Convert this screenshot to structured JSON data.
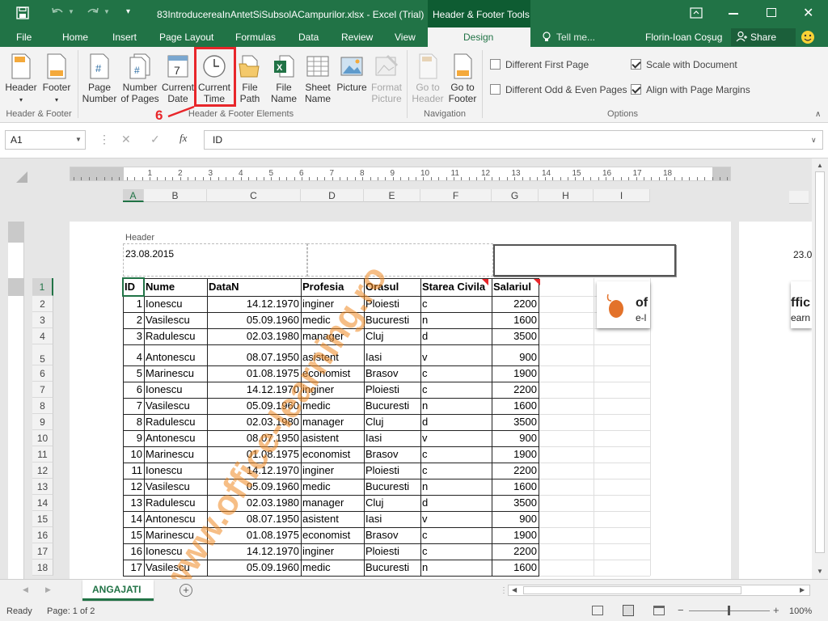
{
  "window": {
    "title": "83IntroducereaInAntetSiSubsolACampurilor.xlsx - Excel (Trial)",
    "contextual_tab": "Header & Footer Tools",
    "user": "Florin-Ioan Coşug",
    "share": "Share",
    "tell_me": "Tell me..."
  },
  "tabs": [
    "File",
    "Home",
    "Insert",
    "Page Layout",
    "Formulas",
    "Data",
    "Review",
    "View",
    "Design"
  ],
  "ribbon": {
    "hf_group": {
      "label": "Header & Footer",
      "header": "Header",
      "footer": "Footer"
    },
    "elements_group": {
      "label": "Header & Footer Elements",
      "items": [
        {
          "l1": "Page",
          "l2": "Number"
        },
        {
          "l1": "Number",
          "l2": "of Pages"
        },
        {
          "l1": "Current",
          "l2": "Date"
        },
        {
          "l1": "Current",
          "l2": "Time"
        },
        {
          "l1": "File",
          "l2": "Path"
        },
        {
          "l1": "File",
          "l2": "Name"
        },
        {
          "l1": "Sheet",
          "l2": "Name"
        },
        {
          "l1": "Picture",
          "l2": ""
        },
        {
          "l1": "Format",
          "l2": "Picture"
        }
      ]
    },
    "nav_group": {
      "label": "Navigation",
      "goto_header_1": "Go to",
      "goto_header_2": "Header",
      "goto_footer_1": "Go to",
      "goto_footer_2": "Footer"
    },
    "options_group": {
      "label": "Options",
      "diff_first": "Different First Page",
      "diff_odd_even": "Different Odd & Even Pages",
      "scale_doc": "Scale with Document",
      "align_margins": "Align with Page Margins",
      "diff_first_checked": false,
      "diff_odd_even_checked": false,
      "scale_doc_checked": true,
      "align_margins_checked": true
    },
    "annotation": "6"
  },
  "formula_bar": {
    "name_box": "A1",
    "content": "ID"
  },
  "ruler": {
    "numbers": [
      "1",
      "2",
      "3",
      "4",
      "5",
      "6",
      "7",
      "8",
      "9",
      "10",
      "11",
      "12",
      "13",
      "14",
      "15",
      "16",
      "17",
      "18"
    ]
  },
  "columns": [
    "A",
    "B",
    "C",
    "D",
    "E",
    "F",
    "G",
    "H",
    "I"
  ],
  "page": {
    "header_label": "Header",
    "header_left": "23.08.2015",
    "page2_header_partial": "23.0"
  },
  "table": {
    "headers": [
      "ID",
      "Nume",
      "DataN",
      "Profesia",
      "Orasul",
      "Starea Civila",
      "Salariul"
    ],
    "rows": [
      [
        "1",
        "Ionescu",
        "14.12.1970",
        "inginer",
        "Ploiesti",
        "c",
        "2200"
      ],
      [
        "2",
        "Vasilescu",
        "05.09.1960",
        "medic",
        "Bucuresti",
        "n",
        "1600"
      ],
      [
        "3",
        "Radulescu",
        "02.03.1980",
        "manager",
        "Cluj",
        "d",
        "3500"
      ],
      [
        "4",
        "Antonescu",
        "08.07.1950",
        "asistent",
        "Iasi",
        "v",
        "900"
      ],
      [
        "5",
        "Marinescu",
        "01.08.1975",
        "economist",
        "Brasov",
        "c",
        "1900"
      ],
      [
        "6",
        "Ionescu",
        "14.12.1970",
        "inginer",
        "Ploiesti",
        "c",
        "2200"
      ],
      [
        "7",
        "Vasilescu",
        "05.09.1960",
        "medic",
        "Bucuresti",
        "n",
        "1600"
      ],
      [
        "8",
        "Radulescu",
        "02.03.1980",
        "manager",
        "Cluj",
        "d",
        "3500"
      ],
      [
        "9",
        "Antonescu",
        "08.07.1950",
        "asistent",
        "Iasi",
        "v",
        "900"
      ],
      [
        "10",
        "Marinescu",
        "01.08.1975",
        "economist",
        "Brasov",
        "c",
        "1900"
      ],
      [
        "11",
        "Ionescu",
        "14.12.1970",
        "inginer",
        "Ploiesti",
        "c",
        "2200"
      ],
      [
        "12",
        "Vasilescu",
        "05.09.1960",
        "medic",
        "Bucuresti",
        "n",
        "1600"
      ],
      [
        "13",
        "Radulescu",
        "02.03.1980",
        "manager",
        "Cluj",
        "d",
        "3500"
      ],
      [
        "14",
        "Antonescu",
        "08.07.1950",
        "asistent",
        "Iasi",
        "v",
        "900"
      ],
      [
        "15",
        "Marinescu",
        "01.08.1975",
        "economist",
        "Brasov",
        "c",
        "1900"
      ],
      [
        "16",
        "Ionescu",
        "14.12.1970",
        "inginer",
        "Ploiesti",
        "c",
        "2200"
      ],
      [
        "17",
        "Vasilescu",
        "05.09.1960",
        "medic",
        "Bucuresti",
        "n",
        "1600"
      ]
    ]
  },
  "row_numbers": [
    "1",
    "2",
    "3",
    "4",
    "5",
    "6",
    "7",
    "8",
    "9",
    "10",
    "11",
    "12",
    "13",
    "14",
    "15",
    "16",
    "17",
    "18"
  ],
  "logo": {
    "text1": "of",
    "text2": "e-l",
    "text3": "ffic",
    "text4": "earn"
  },
  "watermark": "www.office-learning.ro",
  "sheet_tab": "ANGAJATI",
  "status": {
    "ready": "Ready",
    "page": "Page: 1 of 2",
    "zoom": "100%"
  },
  "colors": {
    "excel_green": "#217346",
    "highlight_red": "#e8262a",
    "watermark": "#f08a24"
  }
}
